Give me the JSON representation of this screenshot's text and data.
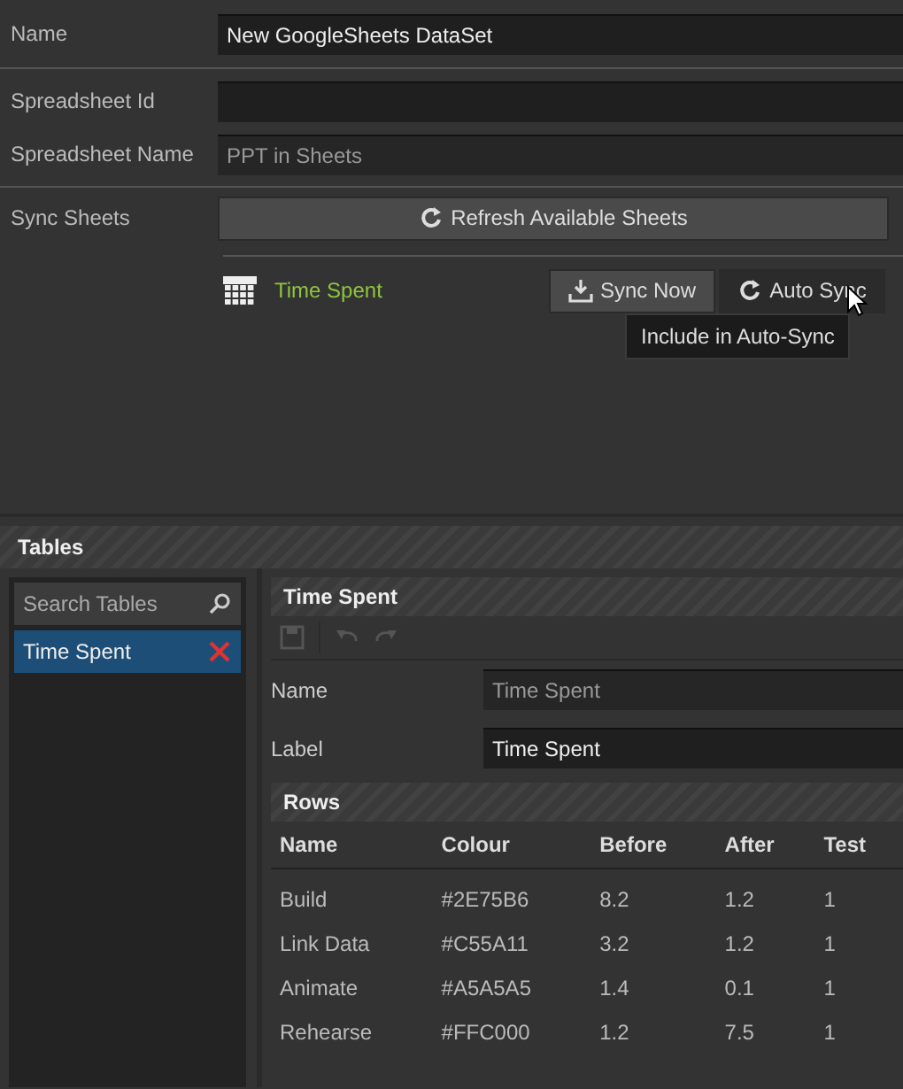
{
  "form": {
    "fields": [
      {
        "label": "Name",
        "value": "New GoogleSheets DataSet",
        "muted": false
      },
      {
        "label": "Spreadsheet Id"
      },
      {
        "label": "Spreadsheet Name",
        "value": "PPT in Sheets",
        "muted": true
      }
    ],
    "sync": {
      "label": "Sync Sheets",
      "refresh_button": "Refresh Available Sheets",
      "sheets": [
        {
          "name": "Time Spent",
          "sync_now": "Sync Now",
          "auto_sync": "Auto Sync",
          "tooltip": "Include in Auto-Sync"
        }
      ]
    }
  },
  "tables": {
    "title": "Tables",
    "search": {
      "placeholder": "Search Tables"
    },
    "items": [
      {
        "name": "Time Spent",
        "selected": true
      }
    ],
    "detail": {
      "title": "Time Spent",
      "toolbar_disabled": true,
      "fields": [
        {
          "label": "Name",
          "value": "Time Spent",
          "muted": true
        },
        {
          "label": "Label",
          "value": "Time Spent",
          "muted": false
        }
      ],
      "rows_title": "Rows",
      "columns": [
        "Name",
        "Colour",
        "Before",
        "After",
        "Test"
      ],
      "rows": [
        [
          "Build",
          "#2E75B6",
          "8.2",
          "1.2",
          "1"
        ],
        [
          "Link Data",
          "#C55A11",
          "3.2",
          "1.2",
          "1"
        ],
        [
          "Animate",
          "#A5A5A5",
          "1.4",
          "0.1",
          "1"
        ],
        [
          "Rehearse",
          "#FFC000",
          "1.2",
          "7.5",
          "1"
        ]
      ]
    }
  }
}
